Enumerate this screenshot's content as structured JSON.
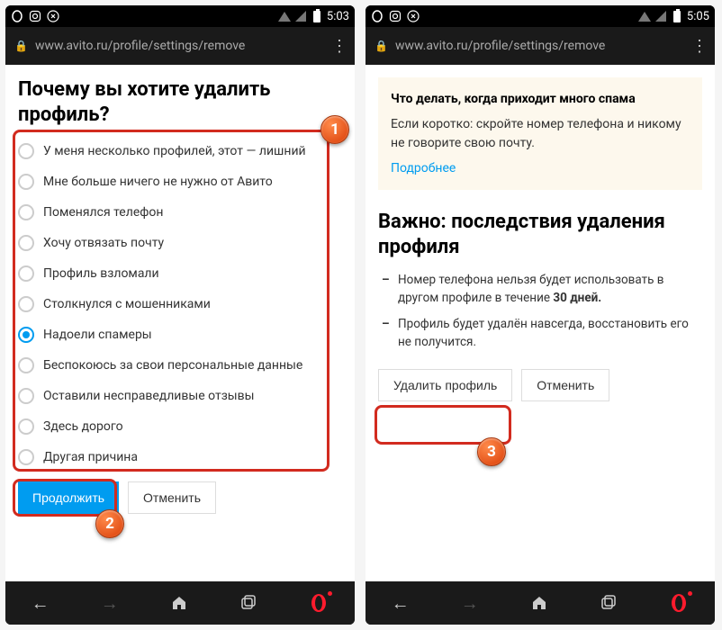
{
  "left": {
    "time": "5:03",
    "url": "www.avito.ru/profile/settings/remove",
    "heading": "Почему вы хотите удалить профиль?",
    "options": [
      "У меня несколько профилей, этот — лишний",
      "Мне больше ничего не нужно от Авито",
      "Поменялся телефон",
      "Хочу отвязать почту",
      "Профиль взломали",
      "Столкнулся с мошенниками",
      "Надоели спамеры",
      "Беспокоюсь за свои персональные данные",
      "Оставили несправедливые отзывы",
      "Здесь дорого",
      "Другая причина"
    ],
    "selected_index": 6,
    "continue": "Продолжить",
    "cancel": "Отменить"
  },
  "right": {
    "time": "5:05",
    "url": "www.avito.ru/profile/settings/remove",
    "info_title": "Что делать, когда приходит много спама",
    "info_body": "Если коротко: скройте номер телефона и никому не говорите свою почту.",
    "info_link": "Подробнее",
    "heading": "Важно: последствия удаления профиля",
    "bullet1_a": "Номер телефона нельзя будет использовать в другом профиле в течение ",
    "bullet1_b": "30 дней.",
    "bullet2": "Профиль будет удалён навсегда, восстановить его не получится.",
    "delete": "Удалить профиль",
    "cancel": "Отменить"
  },
  "badges": {
    "b1": "1",
    "b2": "2",
    "b3": "3"
  }
}
